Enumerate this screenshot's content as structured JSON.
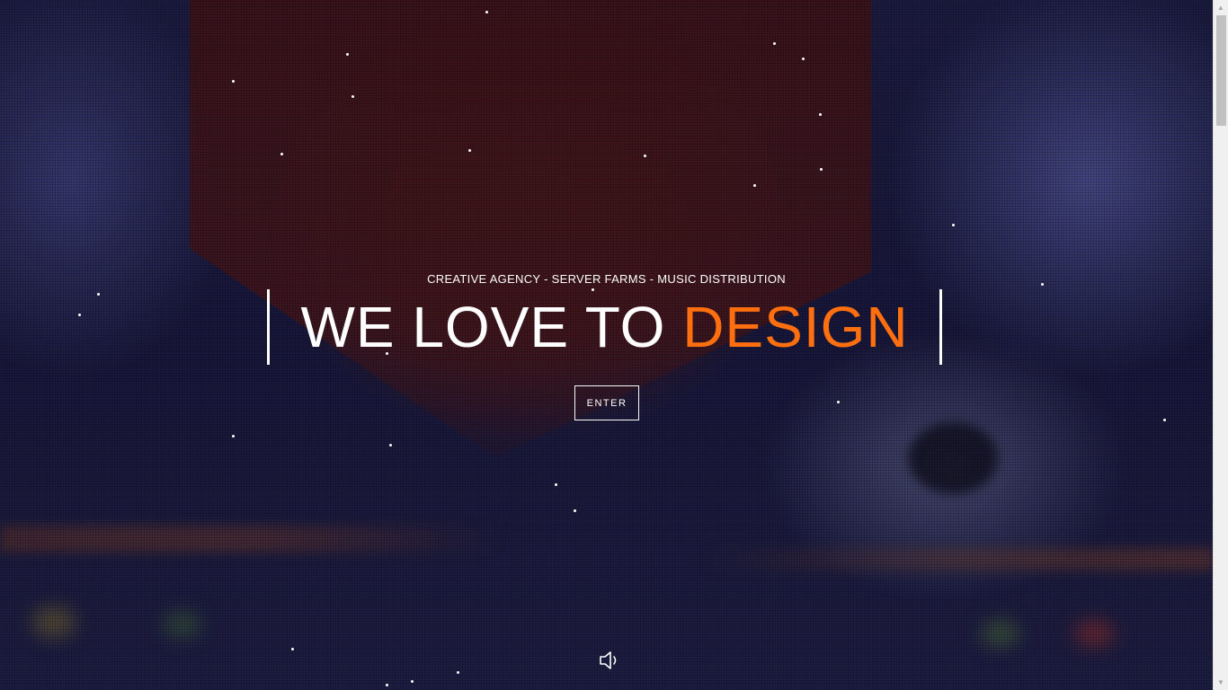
{
  "hero": {
    "tagline": "CREATIVE AGENCY - SERVER FARMS - MUSIC DISTRIBUTION",
    "headline_main": "WE LOVE TO ",
    "headline_accent": "DESIGN",
    "enter_label": "ENTER"
  },
  "icons": {
    "sound": "speaker-icon",
    "scroll_up": "arrow-up-icon",
    "scroll_down": "arrow-down-icon"
  },
  "colors": {
    "accent": "#ff6f0f",
    "text": "#ffffff",
    "background": "#1c1c42"
  }
}
